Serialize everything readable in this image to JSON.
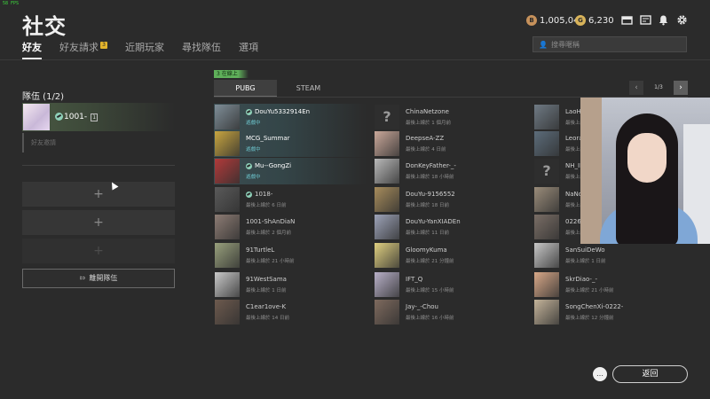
{
  "fps": "58 FPS",
  "header": {
    "title": "社交",
    "tabs": [
      {
        "label": "好友",
        "active": true
      },
      {
        "label": "好友請求",
        "badge": "3"
      },
      {
        "label": "近期玩家"
      },
      {
        "label": "尋找隊伍"
      },
      {
        "label": "選項"
      }
    ],
    "bp_amount": "1,005,046",
    "gcoin_amount": "6,230",
    "search_placeholder": "搜尋暱稱"
  },
  "team": {
    "title": "隊伍 (1/2)",
    "member_name": "1001-",
    "member_rank": "1",
    "member_sub": "好友邀請",
    "empty_slot": "+",
    "leave_label": "離開隊伍"
  },
  "friends_panel": {
    "online_tag": "3 在線上",
    "platform_tabs": [
      "PUBG",
      "STEAM"
    ],
    "page": "1/3"
  },
  "friends": [
    {
      "name": "DouYu5332914En",
      "status": "遊戲中",
      "active": true,
      "steam": true,
      "av": "#7f8e98"
    },
    {
      "name": "MCG_Summar",
      "status": "遊戲中",
      "active": true,
      "steam": false,
      "av": "#c8a540"
    },
    {
      "name": "Mu--GongZi",
      "status": "遊戲中",
      "active": true,
      "steam": true,
      "av": "#b23a3a"
    },
    {
      "name": "1018-",
      "status": "最後上線於 6 日前",
      "steam": true,
      "av": "#5a5a5a"
    },
    {
      "name": "1001-ShAnDiaN",
      "status": "最後上線於 2 個月前",
      "av": "#8d7c74"
    },
    {
      "name": "91TurtleL",
      "status": "最後上線於 21 小時前",
      "av": "#98a07c"
    },
    {
      "name": "91WestSama",
      "status": "最後上線於 1 日前",
      "av": "#c9c9c9"
    },
    {
      "name": "C1ear1ove-K",
      "status": "最後上線於 14 日前",
      "av": "#6d5a4e"
    },
    {
      "name": "ChinaNetzone",
      "status": "最後上線於 1 個月前",
      "question": true
    },
    {
      "name": "DeepseA-ZZ",
      "status": "最後上線於 4 日前",
      "av": "#caa89a"
    },
    {
      "name": "DonKeyFather-_-",
      "status": "最後上線於 18 小時前",
      "av": "#b9b9b9"
    },
    {
      "name": "DouYu-9156552",
      "status": "最後上線於 18 日前",
      "av": "#a78c5c"
    },
    {
      "name": "DouYu-YanXIADEn",
      "status": "最後上線於 11 日前",
      "av": "#9da3b8"
    },
    {
      "name": "GloomyKuma",
      "status": "最後上線於 21 分鐘前",
      "av": "#e0d080"
    },
    {
      "name": "IFT_Q",
      "status": "最後上線於 15 小時前",
      "av": "#b8b0c8"
    },
    {
      "name": "Jay-_-Chou",
      "status": "最後上線於 16 小時前",
      "av": "#7e6a5e"
    },
    {
      "name": "LaoHu",
      "status": "最後上線於",
      "av": "#6f7a84"
    },
    {
      "name": "LeoraL",
      "status": "最後上線於",
      "av": "#5c6c7a"
    },
    {
      "name": "NH_II",
      "status": "最後上線於",
      "question": true
    },
    {
      "name": "NaNde",
      "status": "最後上線於",
      "av": "#9a8c7a"
    },
    {
      "name": "0226_",
      "status": "最後上線於",
      "av": "#7a6e66"
    },
    {
      "name": "SanSuiDeWo",
      "status": "最後上線於 1 日前",
      "av": "#c8c8c8"
    },
    {
      "name": "SkrDiao-_-",
      "status": "最後上線於 21 小時前",
      "av": "#d8a888"
    },
    {
      "name": "SongChenXi-0222-",
      "status": "最後上線於 12 分鐘前",
      "av": "#c4b49a"
    }
  ],
  "footer": {
    "back_label": "返回",
    "chat_icon": "chat-bubble-icon"
  }
}
